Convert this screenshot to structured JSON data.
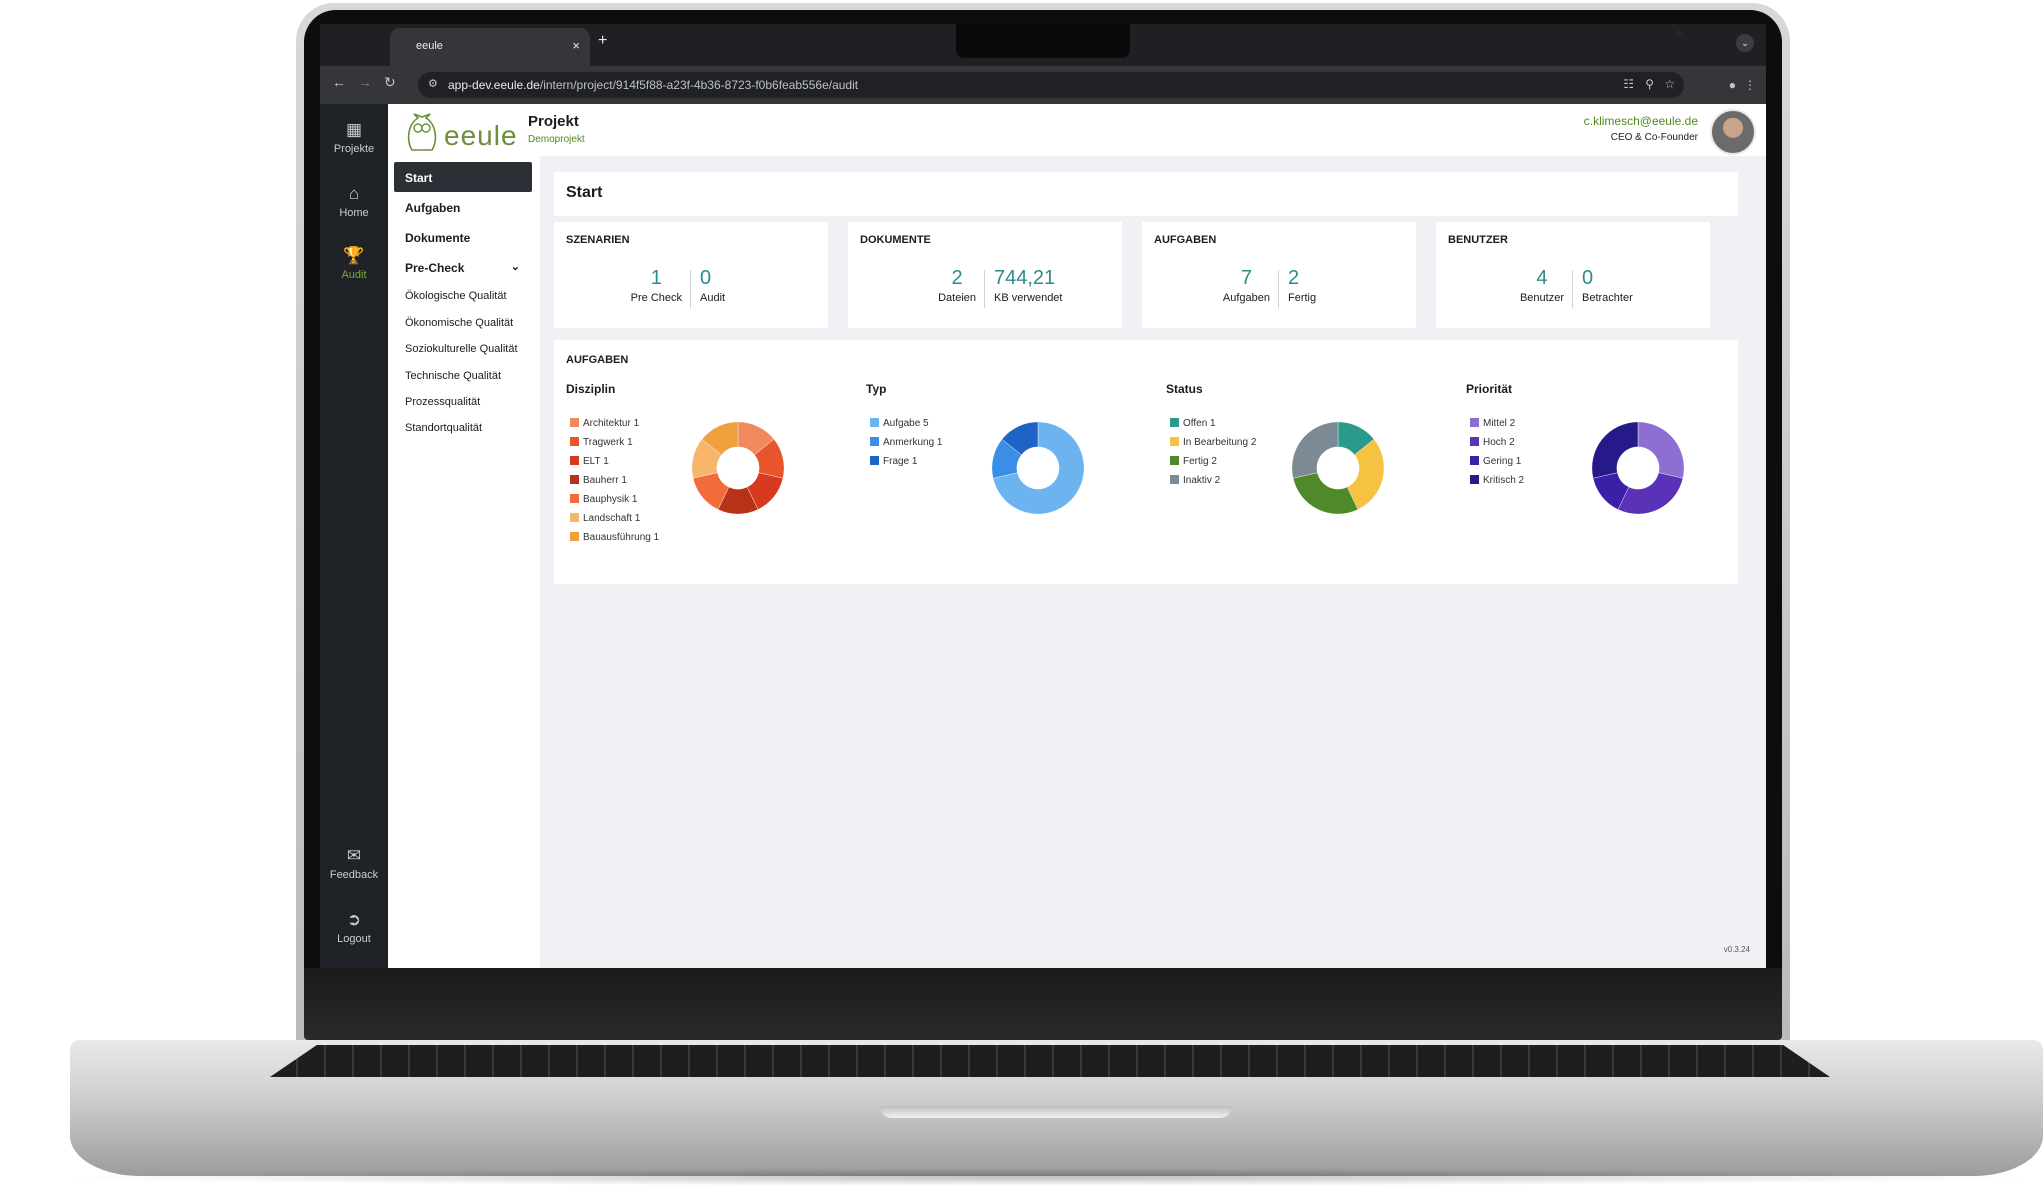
{
  "browser": {
    "tab_title": "eeule",
    "tab_close": "×",
    "new_tab": "+",
    "url_host": "app-dev.eeule.de",
    "url_path": "/intern/project/914f5f88-a23f-4b36-8723-f0b6feab556e/audit"
  },
  "rail": {
    "items": [
      {
        "label": "Projekte",
        "icon": "grid-icon"
      },
      {
        "label": "Home",
        "icon": "home-icon"
      },
      {
        "label": "Audit",
        "icon": "trophy-icon"
      },
      {
        "label": "Feedback",
        "icon": "feedback-icon"
      },
      {
        "label": "Logout",
        "icon": "logout-icon"
      }
    ],
    "active_color": "#7aa93a"
  },
  "header": {
    "logo_text": "eeule",
    "title": "Projekt",
    "subtitle": "Demoprojekt",
    "user_email": "c.klimesch@eeule.de",
    "user_role": "CEO & Co-Founder"
  },
  "sidenav": {
    "items": [
      {
        "label": "Start"
      },
      {
        "label": "Aufgaben"
      },
      {
        "label": "Dokumente"
      },
      {
        "label": "Pre-Check"
      }
    ],
    "subitems": [
      "Ökologische Qualität",
      "Ökonomische Qualität",
      "Soziokulturelle Qualität",
      "Technische Qualität",
      "Prozessqualität",
      "Standortqualität"
    ]
  },
  "page": {
    "title": "Start",
    "version": "v0.3.24"
  },
  "stats": [
    {
      "title": "SZENARIEN",
      "a_value": "1",
      "a_label": "Pre Check",
      "b_value": "0",
      "b_label": "Audit"
    },
    {
      "title": "DOKUMENTE",
      "a_value": "2",
      "a_label": "Dateien",
      "b_value": "744,21",
      "b_label": "KB verwendet"
    },
    {
      "title": "AUFGABEN",
      "a_value": "7",
      "a_label": "Aufgaben",
      "b_value": "2",
      "b_label": "Fertig"
    },
    {
      "title": "BENUTZER",
      "a_value": "4",
      "a_label": "Benutzer",
      "b_value": "0",
      "b_label": "Betrachter"
    }
  ],
  "tasks": {
    "title": "AUFGABEN"
  },
  "accent_color": "#2e8b8a",
  "chart_data": [
    {
      "type": "pie",
      "title": "Disziplin",
      "categories": [
        "Architektur",
        "Tragwerk",
        "ELT",
        "Bauherr",
        "Bauphysik",
        "Landschaft",
        "Bauausführung"
      ],
      "values": [
        1,
        1,
        1,
        1,
        1,
        1,
        1
      ],
      "colors": [
        "#f08a5d",
        "#e8542c",
        "#d83a1f",
        "#b8321a",
        "#f26b3a",
        "#f7b46a",
        "#f0a03c"
      ]
    },
    {
      "type": "pie",
      "title": "Typ",
      "categories": [
        "Aufgabe",
        "Anmerkung",
        "Frage"
      ],
      "values": [
        5,
        1,
        1
      ],
      "colors": [
        "#6cb4f0",
        "#3a8ee6",
        "#1e63c8"
      ]
    },
    {
      "type": "pie",
      "title": "Status",
      "categories": [
        "Offen",
        "In Bearbeitung",
        "Fertig",
        "Inaktiv"
      ],
      "values": [
        1,
        2,
        2,
        2
      ],
      "colors": [
        "#2a9a8a",
        "#f5c242",
        "#4f8a2a",
        "#7b8a94"
      ]
    },
    {
      "type": "pie",
      "title": "Priorität",
      "categories": [
        "Mittel",
        "Hoch",
        "Gering",
        "Kritisch"
      ],
      "values": [
        2,
        2,
        1,
        2
      ],
      "colors": [
        "#8c6fd0",
        "#5a32b8",
        "#3b1fa6",
        "#261a8a"
      ]
    }
  ]
}
